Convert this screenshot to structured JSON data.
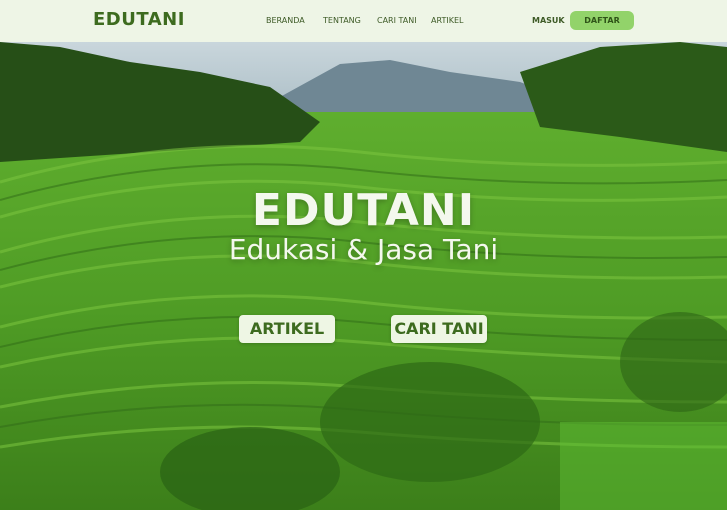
{
  "brand": {
    "logo_text": "EDUTANI"
  },
  "nav": {
    "links": [
      "BERANDA",
      "TENTANG",
      "CARI TANI",
      "ARTIKEL"
    ],
    "login_label": "MASUK",
    "register_label": "DAFTAR"
  },
  "hero": {
    "title": "EDUTANI",
    "subtitle": "Edukasi & Jasa Tani",
    "buttons": [
      "ARTIKEL",
      "CARI TANI"
    ],
    "background": "rice-terrace-photo"
  },
  "colors": {
    "brand_green": "#3d6b1f",
    "accent_green": "#92d36a",
    "nav_bg": "#eef5e6"
  }
}
